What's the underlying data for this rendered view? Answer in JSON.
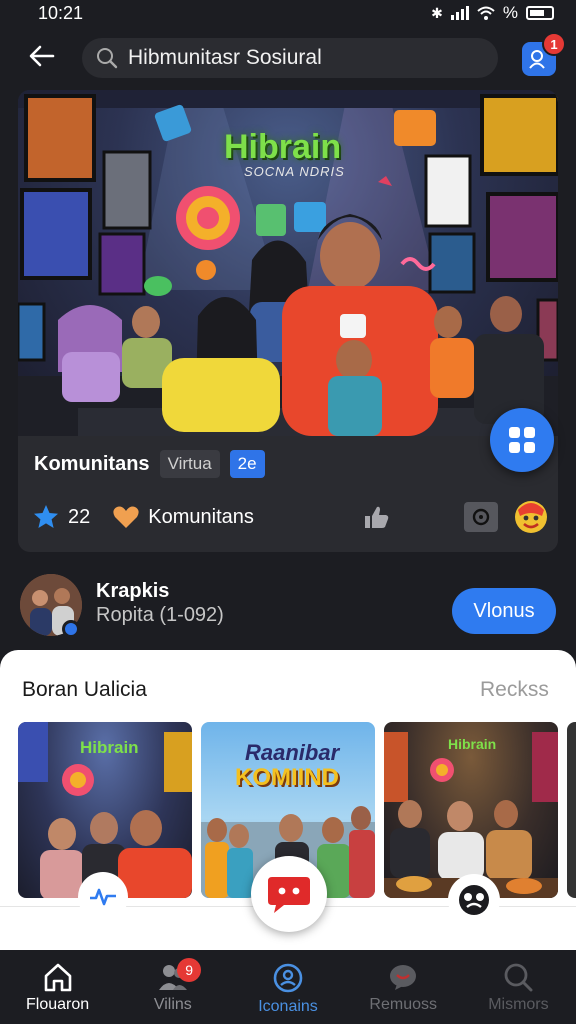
{
  "status_bar": {
    "time": "10:21",
    "battery_text": "%"
  },
  "top_bar": {
    "search_value": "Hibmunitasr Sosiural",
    "notification_count": "1"
  },
  "hero": {
    "image_title": "Hibrain",
    "image_subtitle": "SOCNA NDRIS",
    "card_title": "Komunitans",
    "tag_1": "Virtua",
    "tag_2": "2e",
    "star_count": "22",
    "heart_label": "Komunitans"
  },
  "profile": {
    "name": "Krapkis",
    "subtitle": "Ropita (1-092)",
    "follow_label": "Vlonus"
  },
  "sheet": {
    "title": "Boran Ualicia",
    "link": "Reckss",
    "gallery": [
      {
        "caption": "Hibrain"
      },
      {
        "caption_line1": "Raanibar",
        "caption_line2": "KOMIIND"
      },
      {
        "caption": "Hibrain"
      }
    ]
  },
  "bottom_nav": {
    "items": [
      {
        "label": "Flouaron",
        "icon": "home-icon"
      },
      {
        "label": "Vilins",
        "icon": "people-icon",
        "badge": "9"
      },
      {
        "label": "Iconains",
        "icon": "profile-icon"
      },
      {
        "label": "Remuoss",
        "icon": "chat-icon"
      },
      {
        "label": "Mismors",
        "icon": "search-icon"
      }
    ]
  },
  "colors": {
    "accent": "#2f7bf0",
    "background": "#1c1d22",
    "card": "#2a2b30",
    "badge": "#e53935",
    "active_nav": "#4a90e2"
  }
}
